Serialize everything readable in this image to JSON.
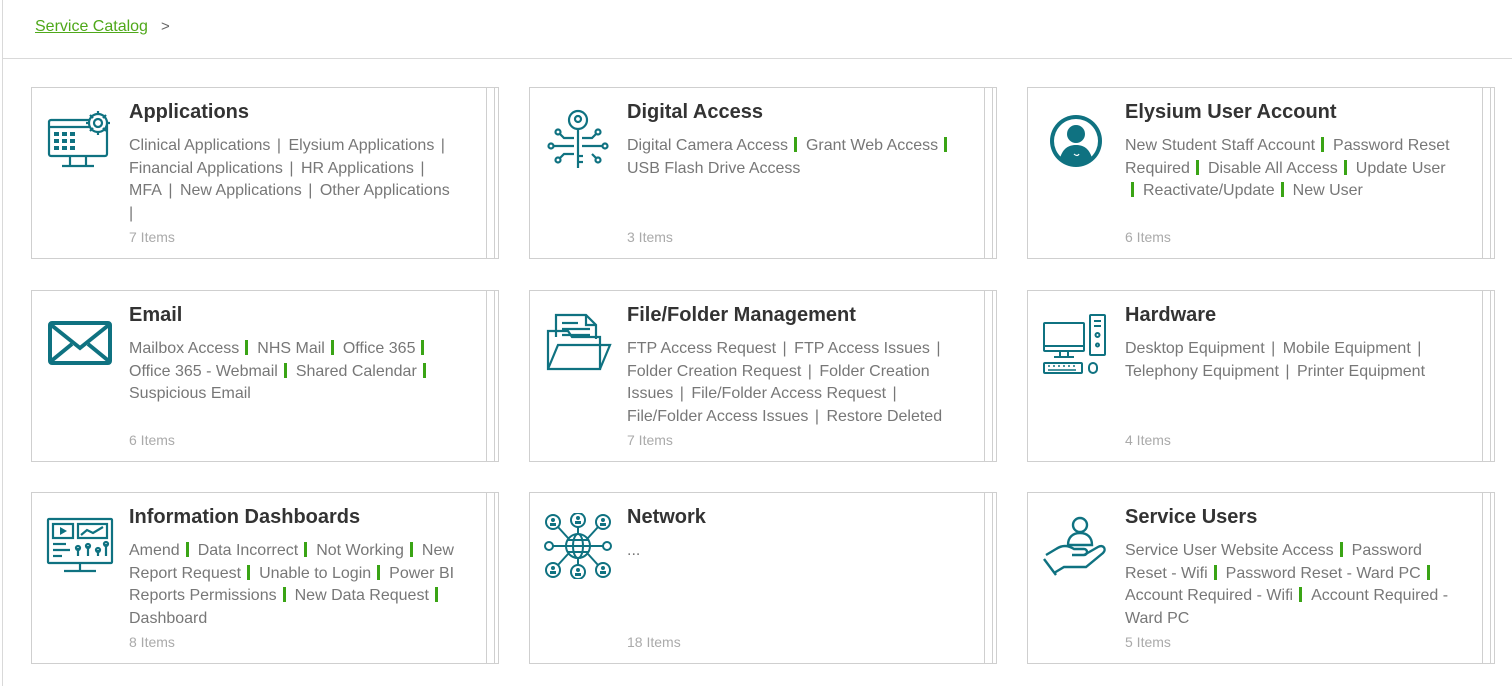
{
  "breadcrumb": {
    "root": "Service Catalog",
    "separator": ">"
  },
  "accent_color": "#4fa81a",
  "icon_color": "#0f7281",
  "cards": [
    {
      "title": "Applications",
      "icon": "app-window-gear-icon",
      "sep": "bar",
      "links": [
        "Clinical Applications",
        "Elysium Applications",
        "Financial Applications",
        "HR Applications",
        "MFA",
        "New Applications",
        "Other Applications"
      ],
      "trailing": "bar",
      "count": "7 Items"
    },
    {
      "title": "Digital Access",
      "icon": "digital-key-icon",
      "sep": "green",
      "links": [
        "Digital Camera Access",
        "Grant Web Access",
        "USB Flash Drive Access"
      ],
      "trailing": "",
      "count": "3 Items"
    },
    {
      "title": "Elysium User Account",
      "icon": "user-circle-icon",
      "sep": "green",
      "links": [
        "New Student Staff Account",
        "Password Reset Required",
        "Disable All Access",
        "Update User",
        "Reactivate/Update",
        "New User"
      ],
      "trailing": "",
      "count": "6 Items"
    },
    {
      "title": "Email",
      "icon": "envelope-icon",
      "sep": "green",
      "links": [
        "Mailbox Access",
        "NHS Mail",
        "Office 365",
        "Office 365 - Webmail",
        "Shared Calendar",
        "Suspicious Email"
      ],
      "trailing": "",
      "count": "6 Items"
    },
    {
      "title": "File/Folder Management",
      "icon": "folder-document-icon",
      "sep": "bar",
      "links": [
        "FTP Access Request",
        "FTP Access Issues",
        "Folder Creation Request",
        "Folder Creation Issues",
        "File/Folder Access Request",
        "File/Folder Access Issues",
        "Restore Deleted ..."
      ],
      "trailing": "",
      "count": "7 Items"
    },
    {
      "title": "Hardware",
      "icon": "desktop-computer-icon",
      "sep": "bar",
      "links": [
        "Desktop Equipment",
        "Mobile Equipment",
        "Telephony Equipment",
        "Printer Equipment"
      ],
      "trailing": "",
      "count": "4 Items"
    },
    {
      "title": "Information Dashboards",
      "icon": "dashboard-monitor-icon",
      "sep": "green",
      "links": [
        "Amend",
        "Data Incorrect",
        "Not Working",
        "New Report Request",
        "Unable to Login",
        "Power BI Reports Permissions",
        "New Data Request",
        "Dashboard"
      ],
      "trailing": "",
      "count": "8 Items"
    },
    {
      "title": "Network",
      "icon": "network-globe-users-icon",
      "sep": "bar",
      "links": [
        "..."
      ],
      "trailing": "",
      "count": "18 Items"
    },
    {
      "title": "Service Users",
      "icon": "hand-user-icon",
      "sep": "green",
      "links": [
        "Service User Website Access",
        "Password Reset - Wifi",
        "Password Reset - Ward PC",
        "Account Required - Wifi",
        "Account Required - Ward PC"
      ],
      "trailing": "",
      "count": "5 Items"
    }
  ]
}
